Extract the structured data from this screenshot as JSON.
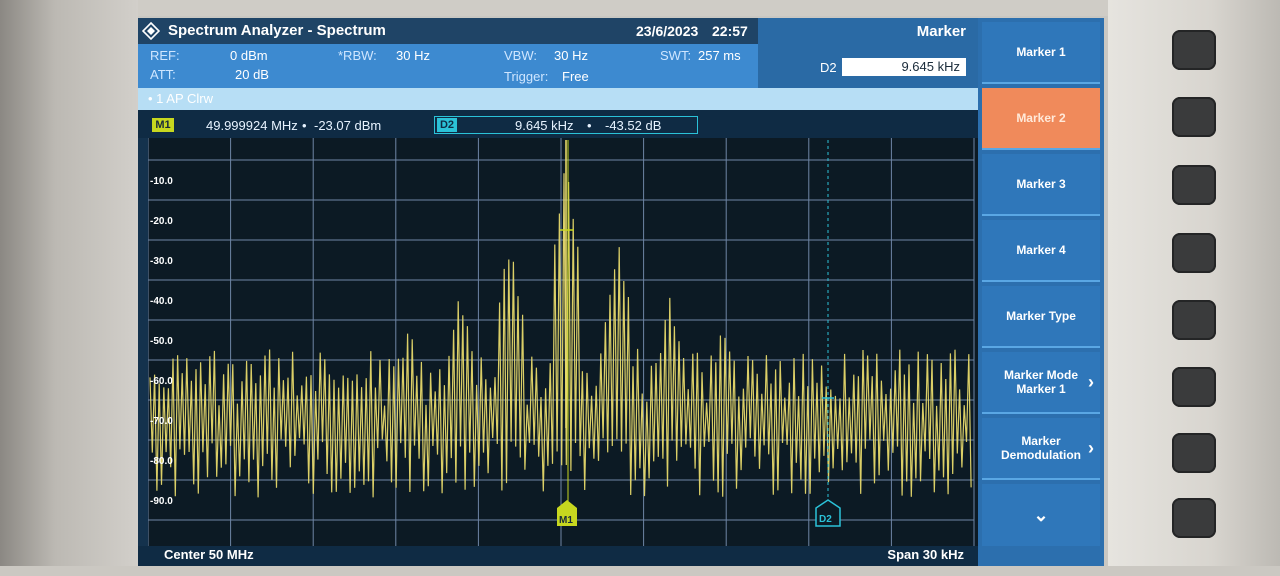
{
  "title": "Spectrum Analyzer - Spectrum",
  "date": "23/6/2023",
  "time": "22:57",
  "params": {
    "ref_label": "REF:",
    "ref_value": "0 dBm",
    "att_label": "ATT:",
    "att_value": "20 dB",
    "rbw_label": "*RBW:",
    "rbw_value": "30 Hz",
    "vbw_label": "VBW:",
    "vbw_value": "30 Hz",
    "trigger_label": "Trigger:",
    "trigger_value": "Free",
    "swt_label": "SWT:",
    "swt_value": "257 ms"
  },
  "marker_header": {
    "title": "Marker",
    "d2_label": "D2",
    "d2_value": "9.645 kHz"
  },
  "trace": {
    "label": "• 1 AP  Clrw"
  },
  "markers": {
    "m1_tag": "M1",
    "m1_freq": "49.999924 MHz",
    "m1_level": "-23.07 dBm",
    "d2_tag": "D2",
    "d2_freq": "9.645 kHz",
    "d2_level": "-43.52 dB"
  },
  "plot": {
    "y_ticks": [
      "-10.0",
      "-20.0",
      "-30.0",
      "-40.0",
      "-50.0",
      "-60.0",
      "-70.0",
      "-80.0",
      "-90.0"
    ],
    "m1_label": "M1",
    "d2_label": "D2",
    "colors": {
      "trace": "#e7d96b",
      "grid": "#6f86a6",
      "m1": "#c7d71f",
      "d2": "#2bc2d8"
    }
  },
  "footer": {
    "center": "Center 50 MHz",
    "span": "Span 30 kHz"
  },
  "softkeys": [
    {
      "label": "Marker 1",
      "sub": ""
    },
    {
      "label": "Marker 2",
      "sub": ""
    },
    {
      "label": "Marker 3",
      "sub": ""
    },
    {
      "label": "Marker 4",
      "sub": ""
    },
    {
      "label": "Marker Type",
      "sub": ""
    },
    {
      "label": "Marker Mode",
      "sub": "Marker 1"
    },
    {
      "label": "Marker",
      "sub": "Demodulation"
    }
  ]
}
